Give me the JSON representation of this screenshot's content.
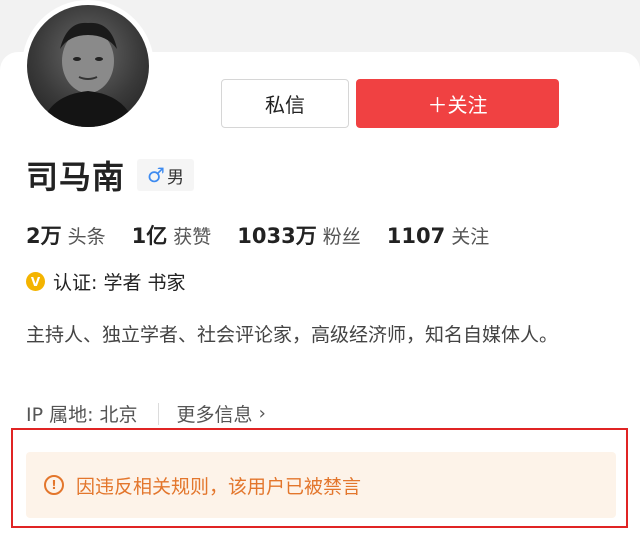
{
  "profile": {
    "name": "司马南",
    "gender_symbol": "♂",
    "gender": "男"
  },
  "actions": {
    "message_label": "私信",
    "follow_label": "＋关注"
  },
  "stats": [
    {
      "num": "2万",
      "label": "头条"
    },
    {
      "num": "1亿",
      "label": "获赞"
    },
    {
      "num": "1033万",
      "label": "粉丝"
    },
    {
      "num": "1107",
      "label": "关注"
    }
  ],
  "verification": {
    "badge": "V",
    "text": "认证: 学者 书家"
  },
  "bio": "主持人、独立学者、社会评论家，高级经济师，知名自媒体人。",
  "meta": {
    "ip": "IP 属地: 北京",
    "more": "更多信息",
    "more_chevron": "›"
  },
  "banner": {
    "icon": "!",
    "text": "因违反相关规则，该用户已被禁言"
  },
  "colors": {
    "follow_button": "#f04142",
    "banner_bg": "#fdf3e9",
    "banner_text": "#e3762c",
    "highlight_border": "#e02424",
    "gender_icon": "#3e8bf0",
    "verify_badge": "#f4b400"
  }
}
